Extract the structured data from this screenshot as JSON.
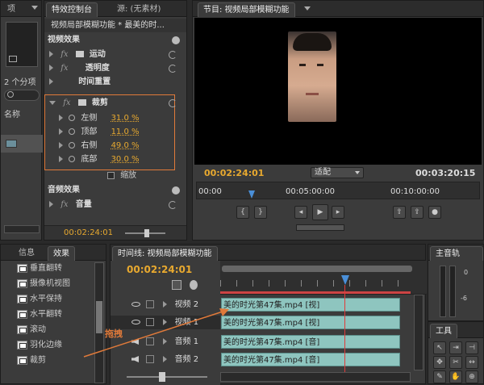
{
  "left_panel": {
    "tab": "项",
    "menu_icon": "dropdown-icon",
    "count_label": "2 个分项",
    "col_name": "名称"
  },
  "effect_controls": {
    "tab_active": "特效控制台",
    "tab_source": "源: (无素材)",
    "breadcrumb": "视频局部模糊功能 * 最美的时...",
    "video_effects_header": "视频效果",
    "motion": "运动",
    "opacity": "透明度",
    "time_remap": "时间重置",
    "crop": "裁剪",
    "crop_params": [
      {
        "name": "左侧",
        "value": "31.0 %"
      },
      {
        "name": "顶部",
        "value": "11.0 %"
      },
      {
        "name": "右侧",
        "value": "49.0 %"
      },
      {
        "name": "底部",
        "value": "30.0 %"
      }
    ],
    "zoom_label": "缩放",
    "audio_effects_header": "音频效果",
    "volume": "音量",
    "timecode": "00:02:24:01"
  },
  "program_monitor": {
    "tab": "节目: 视频局部模糊功能",
    "current_time": "00:02:24:01",
    "fit_select": "适配",
    "duration": "00:03:20:15",
    "ruler": [
      "00:00",
      "00:05:00:00",
      "00:10:00:00"
    ]
  },
  "effects_panel": {
    "tab_info": "信息",
    "tab_effects": "效果",
    "items": [
      "垂直翻转",
      "摄像机视图",
      "水平保持",
      "水平翻转",
      "滚动",
      "羽化边缘",
      "裁剪"
    ]
  },
  "timeline": {
    "tab": "时间线: 视频局部模糊功能",
    "timecode": "00:02:24:01",
    "annotation": "拖拽",
    "tracks": [
      {
        "name": "视频 2",
        "clip": "美的时光第47集.mp4 [视]"
      },
      {
        "name": "视频 1",
        "clip": "美的时光第47集.mp4 [视]"
      },
      {
        "name": "音频 1",
        "clip": "美的时光第47集.mp4 [音]"
      },
      {
        "name": "音频 2",
        "clip": "美的时光第47集.mp4 [音]"
      }
    ]
  },
  "master_audio": {
    "tab": "主音轨",
    "scale_0": "0",
    "scale_6": "-6"
  },
  "tools": {
    "tab": "工具"
  },
  "colors": {
    "accent": "#e8a92f",
    "clip": "#8ec5bf",
    "highlight": "#e07a3a",
    "playhead": "#e03a3a"
  }
}
